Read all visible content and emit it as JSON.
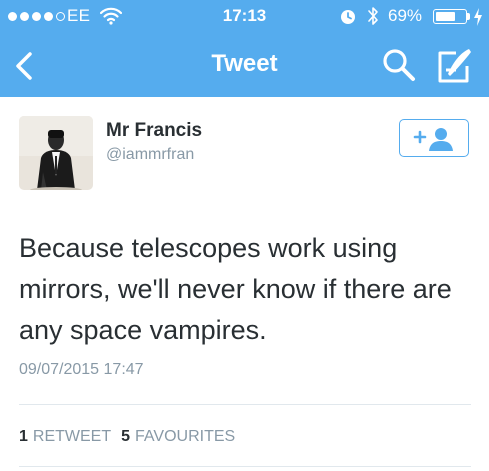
{
  "status_bar": {
    "carrier": "EE",
    "time": "17:13",
    "battery_percent": "69%",
    "battery_level": 0.69,
    "signal_bars_filled": 4,
    "signal_bars_total": 5,
    "icons": [
      "wifi-icon",
      "alarm-icon",
      "bluetooth-icon",
      "charging-icon"
    ]
  },
  "nav": {
    "title": "Tweet",
    "icons": [
      "back-chevron-icon",
      "search-icon",
      "compose-tweet-icon"
    ]
  },
  "tweet": {
    "author_name": "Mr Francis",
    "author_handle": "@iammrfran",
    "text": "Because telescopes work using mirrors, we'll never know if there are any space vampires.",
    "timestamp": "09/07/2015 17:47",
    "retweet_count": "1",
    "retweet_label": "RETWEET",
    "favourite_count": "5",
    "favourite_label": "FAVOURITES",
    "follow_icon": "add-user-icon"
  },
  "colors": {
    "brand_blue": "#55acee",
    "text_dark": "#292f33",
    "text_muted": "#8899a6",
    "divider": "#e1e8ed"
  }
}
